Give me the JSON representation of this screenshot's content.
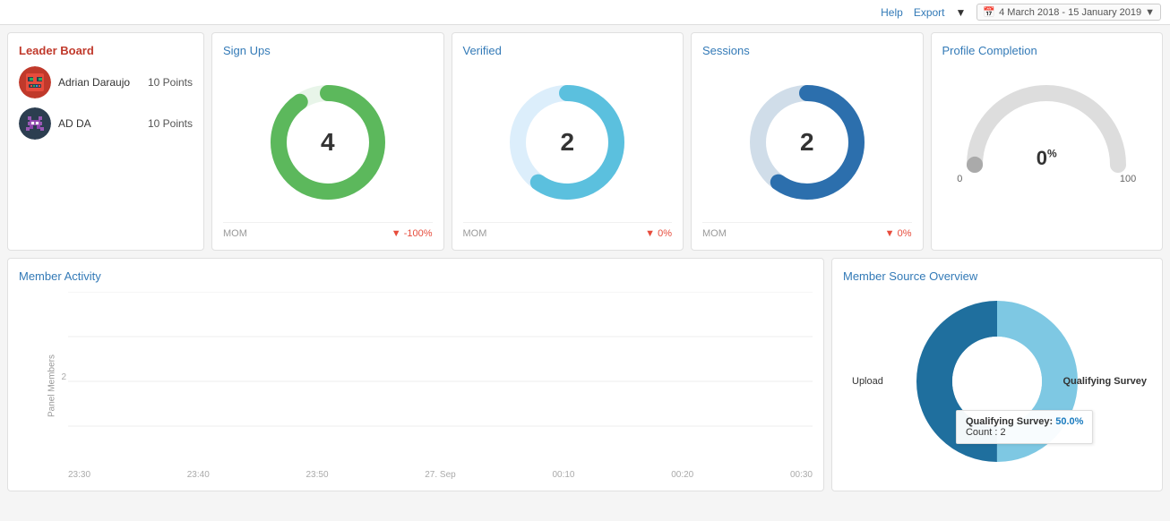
{
  "topbar": {
    "help": "Help",
    "export": "Export",
    "date_range": "4 March 2018 - 15 January 2019"
  },
  "leaderboard": {
    "title": "Leader Board",
    "members": [
      {
        "name": "Adrian Daraujo",
        "points": "10 Points",
        "avatar_color": "#c0392b"
      },
      {
        "name": "AD DA",
        "points": "10 Points",
        "avatar_color": "#2c3e50"
      }
    ]
  },
  "signups": {
    "title": "Sign Ups",
    "value": "4",
    "mom_label": "MOM",
    "mom_value": "-100%",
    "color": "#5cb85c",
    "bg_color": "#e8f5e9",
    "percent": 90
  },
  "verified": {
    "title": "Verified",
    "value": "2",
    "mom_label": "MOM",
    "mom_value": "0%",
    "color": "#5bc0de",
    "bg_color": "#e3f2fd",
    "percent": 60
  },
  "sessions": {
    "title": "Sessions",
    "value": "2",
    "mom_label": "MOM",
    "mom_value": "0%",
    "color": "#2c6fad",
    "bg_color": "#e8eef5",
    "percent": 60
  },
  "profile": {
    "title": "Profile Completion",
    "value": "0",
    "unit": "%",
    "label_min": "0",
    "label_max": "100"
  },
  "activity": {
    "title": "Member Activity",
    "y_axis_label": "Panel Members",
    "x_labels": [
      "23:30",
      "23:40",
      "23:50",
      "27. Sep",
      "00:10",
      "00:20",
      "00:30"
    ],
    "y_values": [
      "",
      "2",
      ""
    ]
  },
  "source": {
    "title": "Member Source Overview",
    "label_left": "Upload",
    "label_right": "Qualifying Survey",
    "tooltip": {
      "label": "Qualifying Survey:",
      "percent": "50.0%",
      "count_label": "Count :",
      "count_value": "2"
    },
    "segments": [
      {
        "label": "Upload",
        "color": "#7ec8e3",
        "percent": 50
      },
      {
        "label": "Qualifying Survey",
        "color": "#1f6f9e",
        "percent": 50
      }
    ]
  }
}
